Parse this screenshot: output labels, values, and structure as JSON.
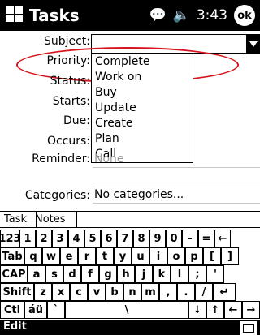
{
  "app": {
    "title": "Tasks"
  },
  "status": {
    "time": "3:43",
    "ok_label": "ok",
    "connection_icon": "chat-bubble-icon",
    "volume_icon": "speaker-icon"
  },
  "form": {
    "subject": {
      "label": "Subject:",
      "value": ""
    },
    "priority_label": "Priority:",
    "status_label": "Status:",
    "starts_label": "Starts:",
    "due_label": "Due:",
    "occurs_label": "Occurs:",
    "reminder": {
      "label": "Reminder:",
      "value": "None"
    },
    "categories": {
      "label": "Categories:",
      "value": "No categories..."
    }
  },
  "dropdown": {
    "options": [
      "Complete",
      "Work on",
      "Buy",
      "Update",
      "Create",
      "Plan",
      "Call"
    ]
  },
  "tabs": {
    "task": "Task",
    "notes": "Notes"
  },
  "keyboard": {
    "row1": [
      "123",
      "1",
      "2",
      "3",
      "4",
      "5",
      "6",
      "7",
      "8",
      "9",
      "0",
      "-",
      "=",
      "←"
    ],
    "row2": [
      "Tab",
      "q",
      "w",
      "e",
      "r",
      "t",
      "y",
      "u",
      "i",
      "o",
      "p",
      "[",
      "]"
    ],
    "row3": [
      "CAP",
      "a",
      "s",
      "d",
      "f",
      "g",
      "h",
      "j",
      "k",
      "l",
      ";",
      "'"
    ],
    "row4": [
      "Shift",
      "z",
      "x",
      "c",
      "v",
      "b",
      "n",
      "m",
      ",",
      ".",
      "/",
      "↵"
    ],
    "row5": [
      "Ctl",
      "áü",
      "`",
      "\\",
      "↓",
      "↑",
      "←",
      "→"
    ]
  },
  "bottom": {
    "menu_edit": "Edit",
    "sip_icon": "keyboard-icon"
  },
  "colors": {
    "highlight": "#d7141e"
  }
}
